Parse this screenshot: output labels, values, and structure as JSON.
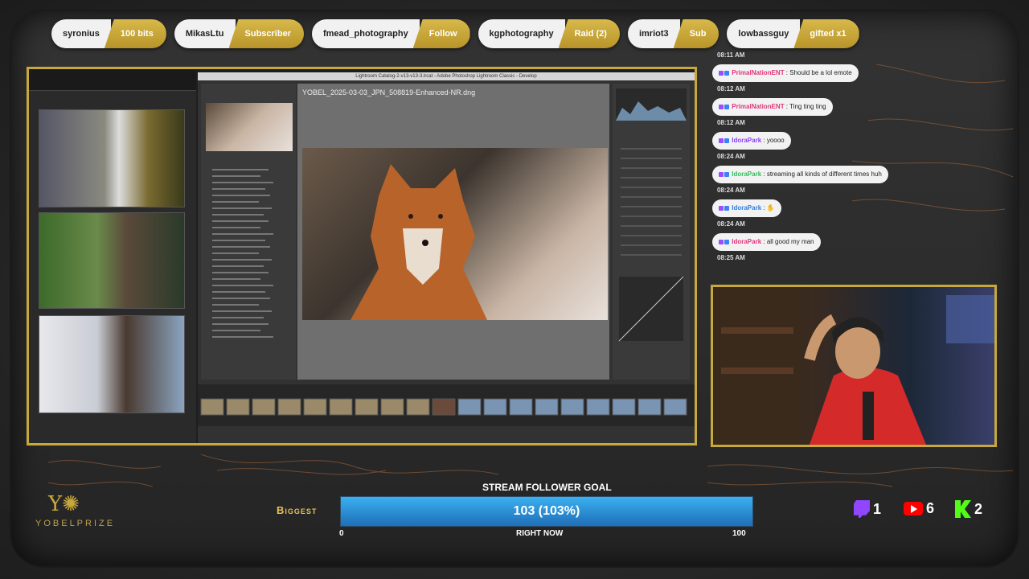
{
  "events": [
    {
      "user": "syronius",
      "tag": "100 bits"
    },
    {
      "user": "MikasLtu",
      "tag": "Subscriber"
    },
    {
      "user": "fmead_photography",
      "tag": "Follow"
    },
    {
      "user": "kgphotography",
      "tag": "Raid (2)"
    },
    {
      "user": "imriot3",
      "tag": "Sub"
    },
    {
      "user": "lowbassguy",
      "tag": "gifted x1"
    }
  ],
  "lightroom": {
    "window_title": "Lightroom Catalog-2-v13-v13-3.lrcat - Adobe Photoshop Lightroom Classic - Develop",
    "filename": "YOBEL_2025-03-03_JPN_508819-Enhanced-NR.dng"
  },
  "chat": [
    {
      "time": "08:11 AM",
      "user": "PrimalNationENT",
      "text": "Should be a lol emote",
      "color": "#e0357a"
    },
    {
      "time": "08:12 AM",
      "user": "PrimalNationENT",
      "text": "Ting ting ting",
      "color": "#e0357a"
    },
    {
      "time": "08:12 AM",
      "user": "IdoraPark",
      "text": "yoooo",
      "color": "#8a3cff"
    },
    {
      "time": "08:24 AM",
      "user": "IdoraPark",
      "text": "streaming all kinds of different times huh",
      "color": "#2fbf5a"
    },
    {
      "time": "08:24 AM",
      "user": "IdoraPark",
      "text": "",
      "color": "#2f7fe0"
    },
    {
      "time": "08:24 AM",
      "user": "IdoraPark",
      "text": "all good my man",
      "color": "#e0357a"
    },
    {
      "time": "08:25 AM",
      "user": "",
      "text": "",
      "color": ""
    }
  ],
  "brand": {
    "name": "YOBELPRIZE"
  },
  "goal": {
    "label_left": "Biggest",
    "title": "STREAM FOLLOWER GOAL",
    "value_text": "103 (103%)",
    "min": "0",
    "max": "100",
    "subtitle": "RIGHT NOW",
    "progress": 1.03
  },
  "stats": [
    {
      "platform": "twitch-icon",
      "count": "1",
      "color": "#9146ff"
    },
    {
      "platform": "youtube-icon",
      "count": "6",
      "color": "#ff0000"
    },
    {
      "platform": "kick-icon",
      "count": "2",
      "color": "#53fc18"
    }
  ]
}
